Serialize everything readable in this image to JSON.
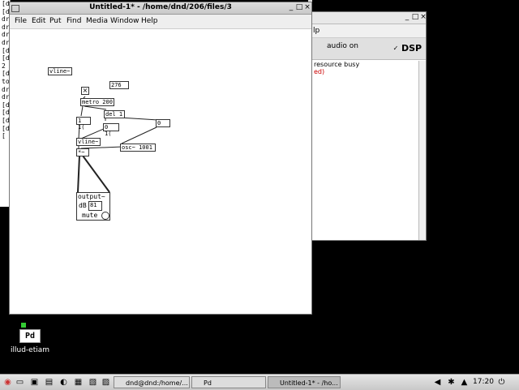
{
  "terminal": {
    "lines": [
      "[d",
      "[d",
      "dr",
      "dr",
      "dr",
      "dr",
      "[d",
      "[d",
      "2",
      "[d",
      "to",
      "dr",
      "dr",
      "[d",
      "[d",
      "[d",
      "[d",
      "["
    ]
  },
  "pd_main": {
    "menu_fragment": "lp",
    "audio_label": "audio on",
    "dsp_checkbox": "✓",
    "dsp_label": "DSP",
    "console": [
      "resource busy",
      "ed)"
    ],
    "error_color": "#cc0000"
  },
  "patch": {
    "title": "Untitled-1* - /home/dnd/206/files/3",
    "menu": [
      "File",
      "Edit",
      "Put",
      "Find",
      "Media",
      "Window",
      "Help"
    ],
    "objects": {
      "vline_top": "vline~",
      "num_276": "276",
      "metro": "metro 200",
      "del": "del 1",
      "msg_1_1": "1 1(",
      "msg_0_1": "0 1(",
      "num_0": "0",
      "vline": "vline~",
      "osc": "osc~ 1001",
      "mul": "*~",
      "output_label": "output~",
      "db_label": "dB",
      "db_value": "81",
      "mute_label": "mute"
    }
  },
  "desktop_icon": {
    "text": "Pd",
    "label": "illud-etiam"
  },
  "taskbar": {
    "items": [
      "dnd@dnd:/home/...",
      "Pd",
      "Untitled-1* - /ho..."
    ],
    "clock": "17:20"
  }
}
